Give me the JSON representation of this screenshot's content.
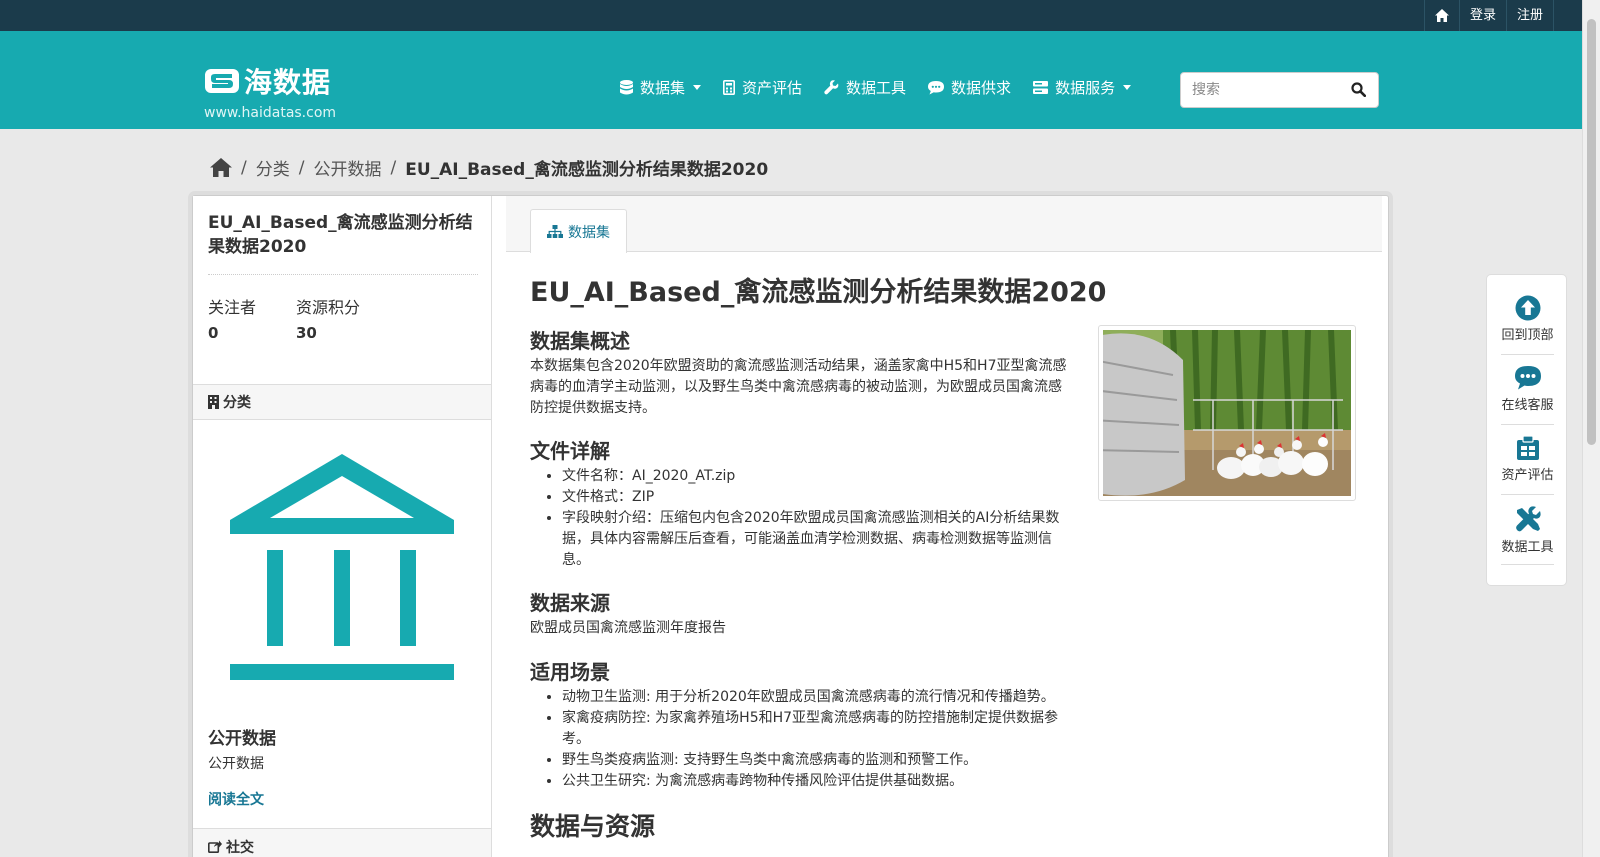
{
  "topbar": {
    "home_icon": "home-icon",
    "login_label": "登录",
    "register_label": "注册"
  },
  "header": {
    "logo_text": "海数据",
    "logo_url": "www.haidatas.com",
    "nav": [
      {
        "label": "数据集",
        "icon": "database-icon",
        "dropdown": true
      },
      {
        "label": "资产评估",
        "icon": "calculator-icon",
        "dropdown": false
      },
      {
        "label": "数据工具",
        "icon": "wrench-icon",
        "dropdown": false
      },
      {
        "label": "数据供求",
        "icon": "comment-icon",
        "dropdown": false
      },
      {
        "label": "数据服务",
        "icon": "server-icon",
        "dropdown": true
      }
    ],
    "search_placeholder": "搜索"
  },
  "breadcrumb": {
    "items": [
      "分类",
      "公开数据"
    ],
    "current": "EU_AI_Based_禽流感监测分析结果数据2020",
    "separator": "/"
  },
  "sidebar": {
    "title": "EU_AI_Based_禽流感监测分析结果数据2020",
    "stats": [
      {
        "label": "关注者",
        "value": "0"
      },
      {
        "label": "资源积分",
        "value": "30"
      }
    ],
    "category_heading": "分类",
    "org_name": "公开数据",
    "org_desc": "公开数据",
    "read_more": "阅读全文",
    "social_heading": "社交"
  },
  "tabs": [
    {
      "label": "数据集",
      "active": true
    }
  ],
  "content": {
    "title": "EU_AI_Based_禽流感监测分析结果数据2020",
    "overview_heading": "数据集概述",
    "overview_text": "本数据集包含2020年欧盟资助的禽流感监测活动结果，涵盖家禽中H5和H7亚型禽流感病毒的血清学主动监测，以及野生鸟类中禽流感病毒的被动监测，为欧盟成员国禽流感防控提供数据支持。",
    "files_heading": "文件详解",
    "files": [
      "文件名称：AI_2020_AT.zip",
      "文件格式：ZIP",
      "字段映射介绍：压缩包内包含2020年欧盟成员国禽流感监测相关的AI分析结果数据，具体内容需解压后查看，可能涵盖血清学检测数据、病毒检测数据等监测信息。"
    ],
    "source_heading": "数据来源",
    "source_text": "欧盟成员国禽流感监测年度报告",
    "usage_heading": "适用场景",
    "usage": [
      "动物卫生监测: 用于分析2020年欧盟成员国禽流感病毒的流行情况和传播趋势。",
      "家禽疫病防控: 为家禽养殖场H5和H7亚型禽流感病毒的防控措施制定提供数据参考。",
      "野生鸟类疫病监测: 支持野生鸟类中禽流感病毒的监测和预警工作。",
      "公共卫生研究: 为禽流感病毒跨物种传播风险评估提供基础数据。"
    ],
    "resources_heading": "数据与资源"
  },
  "float_panel": [
    {
      "label": "回到顶部",
      "icon": "arrow-up-circle-icon"
    },
    {
      "label": "在线客服",
      "icon": "chat-bubble-icon"
    },
    {
      "label": "资产评估",
      "icon": "clipboard-icon"
    },
    {
      "label": "数据工具",
      "icon": "tools-icon"
    }
  ],
  "colors": {
    "topbar": "#1b3b4b",
    "masthead": "#17aab0",
    "accent": "#187794",
    "icon_teal": "#17aab0"
  }
}
